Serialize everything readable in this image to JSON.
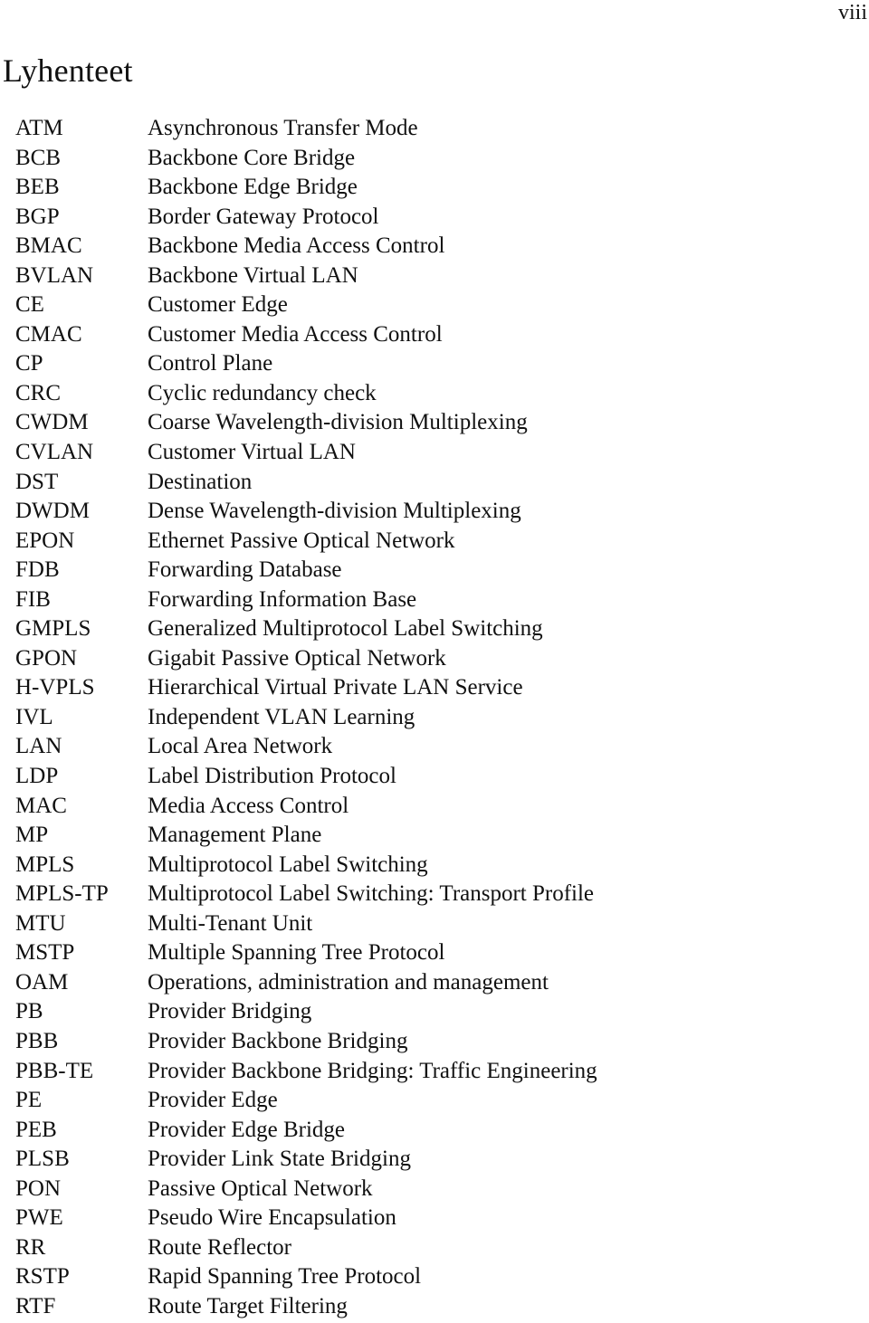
{
  "page": {
    "number": "viii",
    "title": "Lyhenteet"
  },
  "abbreviations": [
    {
      "term": "ATM",
      "definition": "Asynchronous Transfer Mode"
    },
    {
      "term": "BCB",
      "definition": "Backbone Core Bridge"
    },
    {
      "term": "BEB",
      "definition": "Backbone Edge Bridge"
    },
    {
      "term": "BGP",
      "definition": "Border Gateway Protocol"
    },
    {
      "term": "BMAC",
      "definition": "Backbone Media Access Control"
    },
    {
      "term": "BVLAN",
      "definition": "Backbone Virtual LAN"
    },
    {
      "term": "CE",
      "definition": "Customer Edge"
    },
    {
      "term": "CMAC",
      "definition": "Customer Media Access Control"
    },
    {
      "term": "CP",
      "definition": "Control Plane"
    },
    {
      "term": "CRC",
      "definition": "Cyclic redundancy check"
    },
    {
      "term": "CWDM",
      "definition": "Coarse Wavelength-division Multiplexing"
    },
    {
      "term": "CVLAN",
      "definition": "Customer Virtual LAN"
    },
    {
      "term": "DST",
      "definition": "Destination"
    },
    {
      "term": "DWDM",
      "definition": "Dense Wavelength-division Multiplexing"
    },
    {
      "term": "EPON",
      "definition": "Ethernet Passive Optical Network"
    },
    {
      "term": "FDB",
      "definition": "Forwarding Database"
    },
    {
      "term": "FIB",
      "definition": "Forwarding Information Base"
    },
    {
      "term": "GMPLS",
      "definition": "Generalized Multiprotocol Label Switching"
    },
    {
      "term": "GPON",
      "definition": "Gigabit Passive Optical Network"
    },
    {
      "term": "H-VPLS",
      "definition": "Hierarchical Virtual Private LAN Service"
    },
    {
      "term": "IVL",
      "definition": "Independent VLAN Learning"
    },
    {
      "term": "LAN",
      "definition": "Local Area Network"
    },
    {
      "term": "LDP",
      "definition": "Label Distribution Protocol"
    },
    {
      "term": "MAC",
      "definition": "Media Access Control"
    },
    {
      "term": "MP",
      "definition": "Management Plane"
    },
    {
      "term": "MPLS",
      "definition": "Multiprotocol Label Switching"
    },
    {
      "term": "MPLS-TP",
      "definition": "Multiprotocol Label Switching: Transport Profile"
    },
    {
      "term": "MTU",
      "definition": "Multi-Tenant Unit"
    },
    {
      "term": "MSTP",
      "definition": "Multiple Spanning Tree Protocol"
    },
    {
      "term": "OAM",
      "definition": "Operations, administration and management"
    },
    {
      "term": "PB",
      "definition": "Provider Bridging"
    },
    {
      "term": "PBB",
      "definition": "Provider Backbone Bridging"
    },
    {
      "term": "PBB-TE",
      "definition": "Provider Backbone Bridging: Traffic Engineering"
    },
    {
      "term": "PE",
      "definition": "Provider Edge"
    },
    {
      "term": "PEB",
      "definition": "Provider Edge Bridge"
    },
    {
      "term": "PLSB",
      "definition": "Provider Link State Bridging"
    },
    {
      "term": "PON",
      "definition": "Passive Optical Network"
    },
    {
      "term": "PWE",
      "definition": "Pseudo Wire Encapsulation"
    },
    {
      "term": "RR",
      "definition": "Route Reflector"
    },
    {
      "term": "RSTP",
      "definition": "Rapid Spanning Tree Protocol"
    },
    {
      "term": "RTF",
      "definition": "Route Target Filtering"
    }
  ]
}
